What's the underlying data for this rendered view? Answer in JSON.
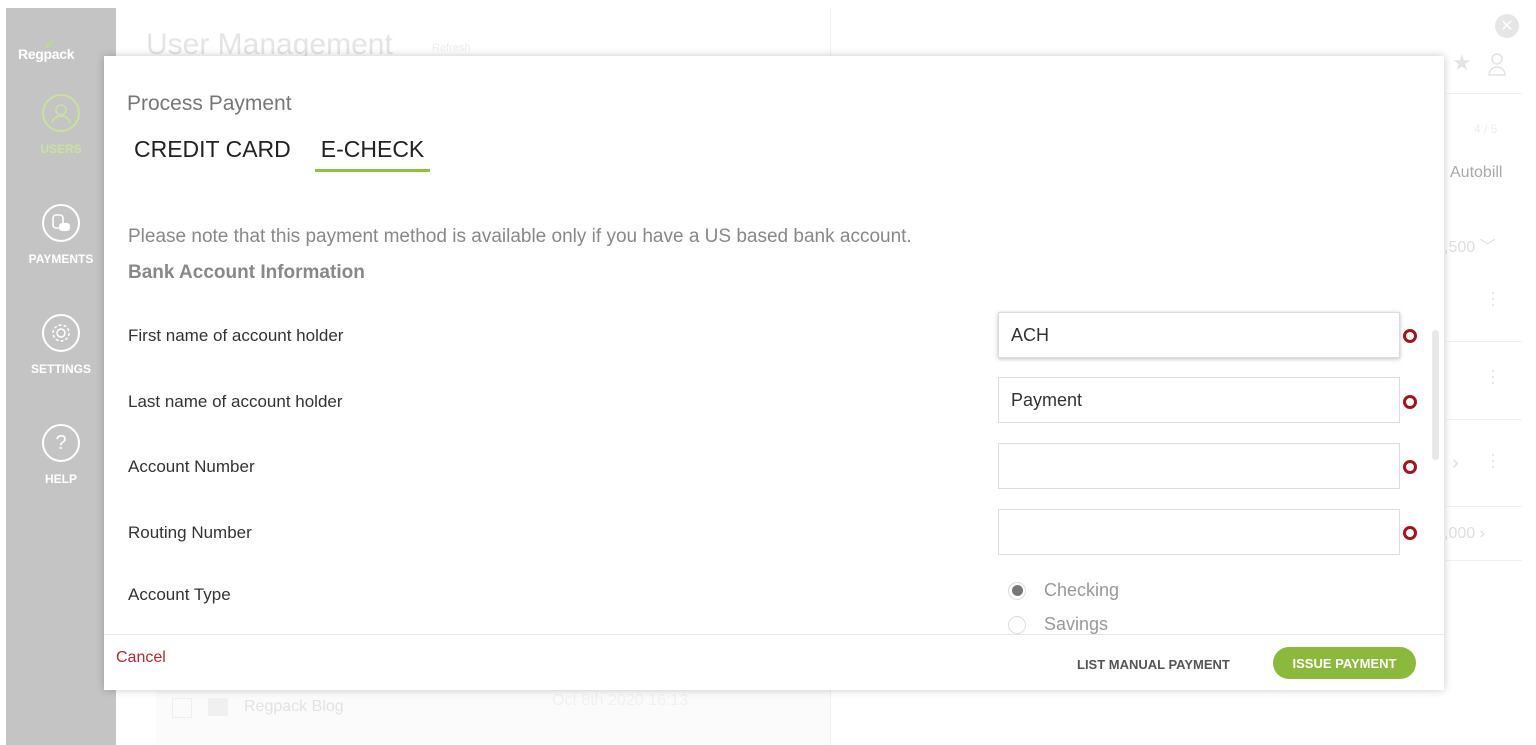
{
  "background": {
    "logo": "Regpack",
    "page_title": "User Management",
    "refresh_label": "Refresh",
    "nav": [
      {
        "label": "USERS",
        "icon": "user-icon",
        "active": true
      },
      {
        "label": "PAYMENTS",
        "icon": "coins-icon",
        "active": false
      },
      {
        "label": "SETTINGS",
        "icon": "gear-icon",
        "active": false
      },
      {
        "label": "HELP",
        "icon": "question-icon",
        "active": false
      }
    ],
    "right_panel": {
      "counter": "4 / 5",
      "autobill_label": "Autobill",
      "amount_1": ",500",
      "amount_2": ",000"
    },
    "list_row": {
      "name": "Regpack Blog",
      "date": "Oct 8th 2020 16:13"
    }
  },
  "modal": {
    "title": "Process Payment",
    "tabs": [
      {
        "label": "CREDIT CARD",
        "active": false
      },
      {
        "label": "E-CHECK",
        "active": true
      }
    ],
    "note": "Please note that this payment method is available only if you have a US based bank account.",
    "section_title": "Bank Account Information",
    "fields": [
      {
        "label": "First name of account holder",
        "value": "ACH",
        "required": true
      },
      {
        "label": "Last name of account holder",
        "value": "Payment",
        "required": true
      },
      {
        "label": "Account Number",
        "value": "",
        "required": true
      },
      {
        "label": "Routing Number",
        "value": "",
        "required": true
      }
    ],
    "account_type": {
      "label": "Account Type",
      "options": [
        {
          "label": "Checking",
          "selected": true
        },
        {
          "label": "Savings",
          "selected": false
        }
      ]
    },
    "footer": {
      "cancel_label": "Cancel",
      "list_manual_label": "LIST MANUAL PAYMENT",
      "issue_label": "ISSUE PAYMENT"
    }
  },
  "colors": {
    "accent_green": "#8ab93b",
    "required_red": "#a8131b",
    "cancel_red": "#b3282d"
  }
}
